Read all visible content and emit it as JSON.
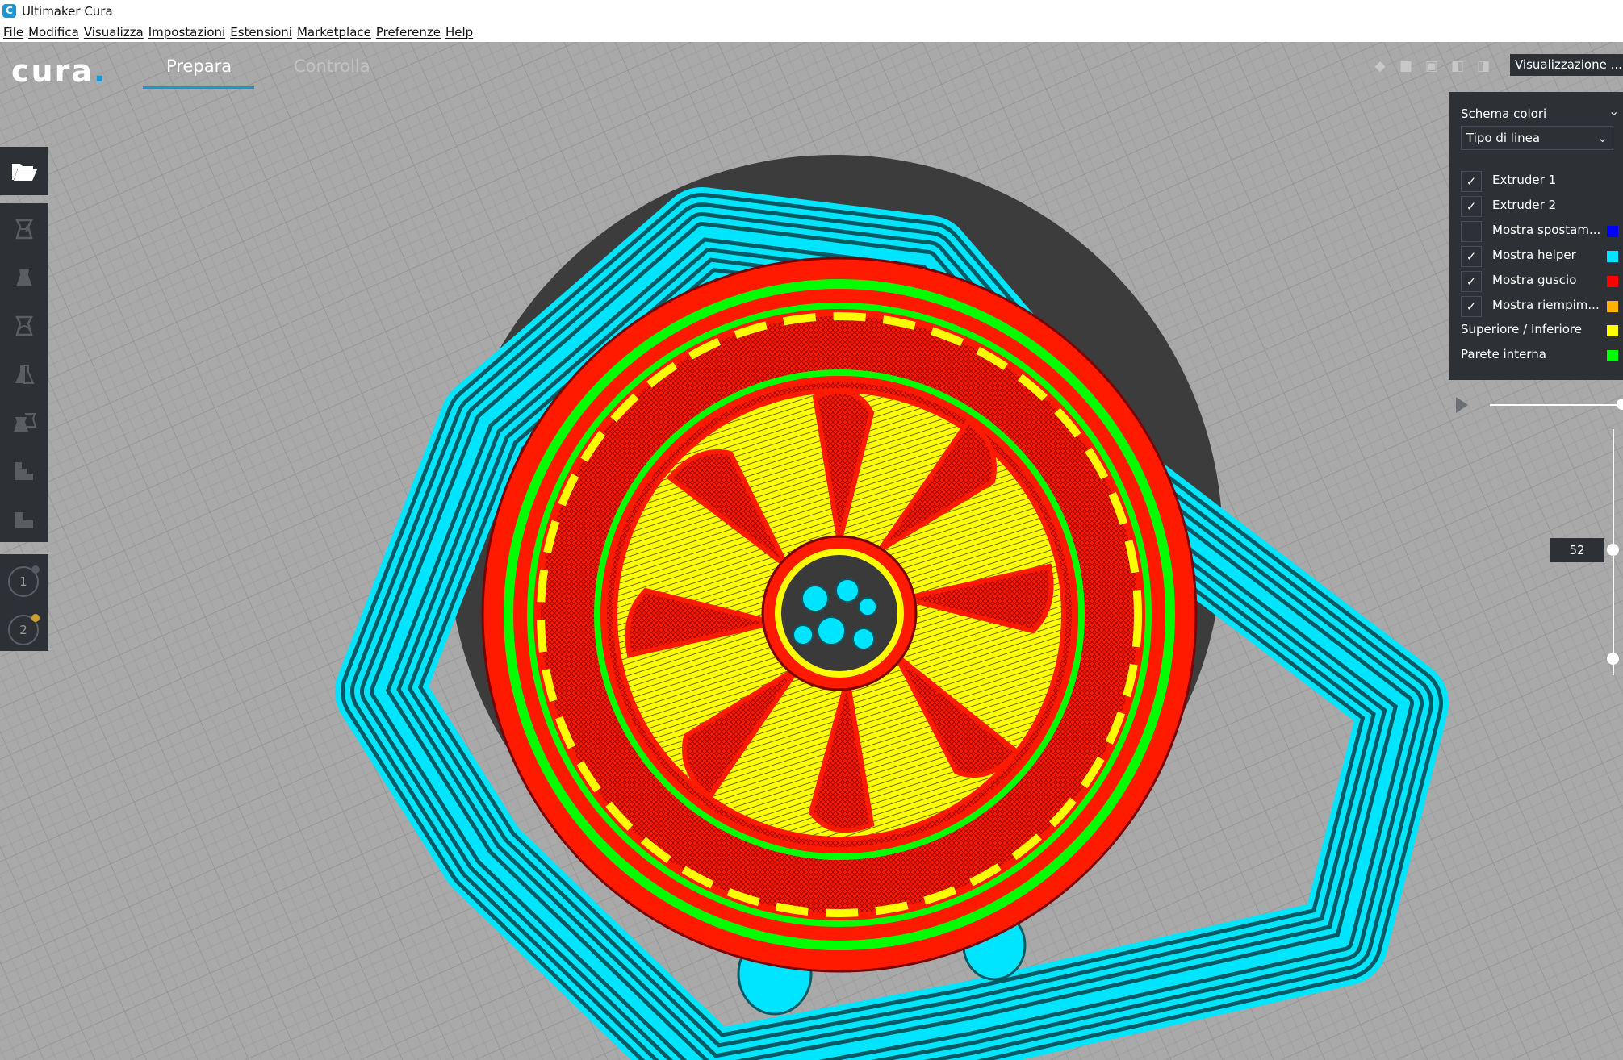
{
  "window": {
    "title": "Ultimaker Cura",
    "app_icon": "C"
  },
  "menu": [
    "File",
    "Modifica",
    "Visualizza",
    "Impostazioni",
    "Estensioni",
    "Marketplace",
    "Preferenze",
    "Help"
  ],
  "header": {
    "logo_text": "cura",
    "logo_dot": ".",
    "tabs": [
      {
        "label": "Prepara",
        "active": true
      },
      {
        "label": "Controlla",
        "active": false
      }
    ],
    "view_dropdown": "Visualizzazione ..."
  },
  "toolbar": {
    "extruders": [
      "1",
      "2"
    ],
    "extruder_colors": [
      "#555a60",
      "#c8a02a"
    ]
  },
  "color_panel": {
    "scheme_label": "Schema colori",
    "scheme_value": "Tipo di linea",
    "items": [
      {
        "label": "Extruder 1",
        "checked": true,
        "has_checkbox": true
      },
      {
        "label": "Extruder 2",
        "checked": true,
        "has_checkbox": true
      },
      {
        "label": "Mostra spostam...",
        "checked": false,
        "has_checkbox": true,
        "color": "#0000ff"
      },
      {
        "label": "Mostra helper",
        "checked": true,
        "has_checkbox": true,
        "color": "#00e5ff"
      },
      {
        "label": "Mostra guscio",
        "checked": true,
        "has_checkbox": true,
        "color": "#ff0000"
      },
      {
        "label": "Mostra riempim...",
        "checked": true,
        "has_checkbox": true,
        "color": "#ffb300"
      },
      {
        "label": "Superiore / Inferiore",
        "has_checkbox": false,
        "color": "#ffff00"
      },
      {
        "label": "Parete interna",
        "has_checkbox": false,
        "color": "#00ff00"
      }
    ]
  },
  "layer_slider": {
    "current_layer": "52"
  },
  "colors": {
    "accent": "#1a96d4",
    "panel": "#2d3035",
    "helper": "#00e5ff",
    "shell": "#ff1a00",
    "top_bottom": "#ffff00",
    "inner_wall": "#00ff00"
  }
}
